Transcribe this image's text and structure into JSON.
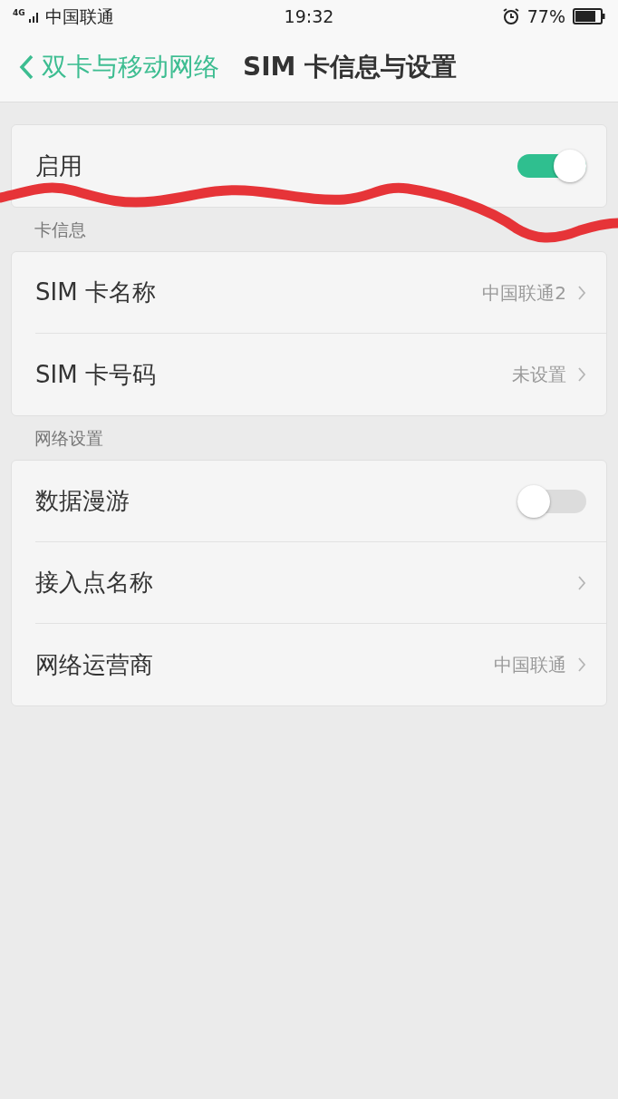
{
  "status_bar": {
    "network": "4G",
    "carrier": "中国联通",
    "time": "19:32",
    "battery": "77%"
  },
  "header": {
    "back": "双卡与移动网络",
    "title": "SIM 卡信息与设置"
  },
  "sections": [
    {
      "rows": [
        {
          "kind": "toggle",
          "label": "启用",
          "on": true
        }
      ]
    },
    {
      "title": "卡信息",
      "rows": [
        {
          "kind": "link",
          "label": "SIM 卡名称",
          "value": "中国联通2"
        },
        {
          "kind": "link",
          "label": "SIM 卡号码",
          "value": "未设置"
        }
      ]
    },
    {
      "title": "网络设置",
      "rows": [
        {
          "kind": "toggle",
          "label": "数据漫游",
          "on": false
        },
        {
          "kind": "link",
          "label": "接入点名称"
        },
        {
          "kind": "link",
          "label": "网络运营商",
          "value": "中国联通"
        }
      ]
    }
  ]
}
